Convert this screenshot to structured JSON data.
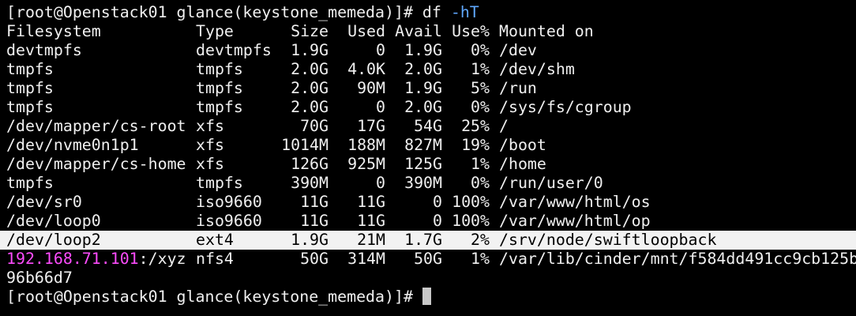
{
  "terminal": {
    "prompt": "[root@Openstack01 glance(keystone_memeda)]#",
    "command": "df",
    "command_flag": "-hT",
    "headers": {
      "filesystem": "Filesystem",
      "type": "Type",
      "size": "Size",
      "used": "Used",
      "avail": "Avail",
      "use_pct": "Use%",
      "mounted_on": "Mounted on"
    },
    "rows": [
      {
        "filesystem": "devtmpfs",
        "type": "devtmpfs",
        "size": "1.9G",
        "used": "0",
        "avail": "1.9G",
        "use_pct": "0%",
        "mount": "/dev"
      },
      {
        "filesystem": "tmpfs",
        "type": "tmpfs",
        "size": "2.0G",
        "used": "4.0K",
        "avail": "2.0G",
        "use_pct": "1%",
        "mount": "/dev/shm"
      },
      {
        "filesystem": "tmpfs",
        "type": "tmpfs",
        "size": "2.0G",
        "used": "90M",
        "avail": "1.9G",
        "use_pct": "5%",
        "mount": "/run"
      },
      {
        "filesystem": "tmpfs",
        "type": "tmpfs",
        "size": "2.0G",
        "used": "0",
        "avail": "2.0G",
        "use_pct": "0%",
        "mount": "/sys/fs/cgroup"
      },
      {
        "filesystem": "/dev/mapper/cs-root",
        "type": "xfs",
        "size": "70G",
        "used": "17G",
        "avail": "54G",
        "use_pct": "25%",
        "mount": "/"
      },
      {
        "filesystem": "/dev/nvme0n1p1",
        "type": "xfs",
        "size": "1014M",
        "used": "188M",
        "avail": "827M",
        "use_pct": "19%",
        "mount": "/boot"
      },
      {
        "filesystem": "/dev/mapper/cs-home",
        "type": "xfs",
        "size": "126G",
        "used": "925M",
        "avail": "125G",
        "use_pct": "1%",
        "mount": "/home"
      },
      {
        "filesystem": "tmpfs",
        "type": "tmpfs",
        "size": "390M",
        "used": "0",
        "avail": "390M",
        "use_pct": "0%",
        "mount": "/run/user/0"
      },
      {
        "filesystem": "/dev/sr0",
        "type": "iso9660",
        "size": "11G",
        "used": "11G",
        "avail": "0",
        "use_pct": "100%",
        "mount": "/var/www/html/os"
      },
      {
        "filesystem": "/dev/loop0",
        "type": "iso9660",
        "size": "11G",
        "used": "11G",
        "avail": "0",
        "use_pct": "100%",
        "mount": "/var/www/html/op"
      },
      {
        "filesystem": "/dev/loop2",
        "type": "ext4",
        "size": "1.9G",
        "used": "21M",
        "avail": "1.7G",
        "use_pct": "2%",
        "mount": "/srv/node/swiftloopback"
      }
    ],
    "nfs_row": {
      "ip": "192.168.71.101",
      "path": ":/xyz",
      "type": "nfs4",
      "size": "50G",
      "used": "314M",
      "avail": "50G",
      "use_pct": "1%",
      "mount": "/var/lib/cinder/mnt/f584dd491cc9cb125b",
      "mount_wrap": "96b66d7"
    },
    "highlight_color": "#f2f2f2",
    "flag_color": "#5fa8ff",
    "ip_color": "#ff4cff"
  }
}
